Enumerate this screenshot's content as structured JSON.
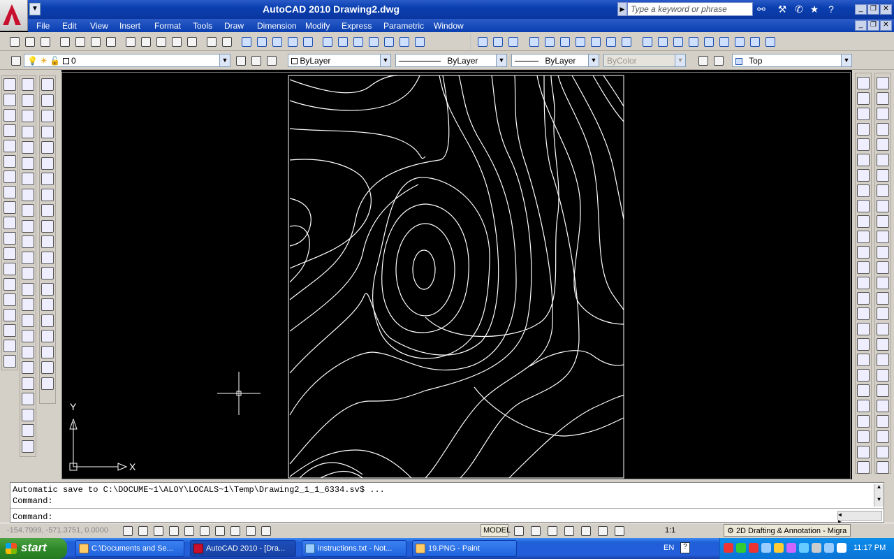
{
  "window": {
    "title": "AutoCAD 2010    Drawing2.dwg",
    "search_placeholder": "Type a keyword or phrase"
  },
  "menu": [
    "File",
    "Edit",
    "View",
    "Insert",
    "Format",
    "Tools",
    "Draw",
    "Dimension",
    "Modify",
    "Express",
    "Parametric",
    "Window"
  ],
  "layers_toolbar": {
    "layer_value": "0",
    "color_value": "ByLayer",
    "linetype_value": "ByLayer",
    "lineweight_value": "ByLayer",
    "plotstyle_value": "ByColor",
    "view_value": "Top"
  },
  "ucs": {
    "x_label": "X",
    "y_label": "Y"
  },
  "command": {
    "history_line": "Automatic save to C:\\DOCUME~1\\ALOY\\LOCALS~1\\Temp\\Drawing2_1_1_6334.sv$ ...",
    "prev_prompt": "Command:",
    "prompt": "Command:"
  },
  "status": {
    "coordinates": "-154.7999, -571.3751, 0.0000",
    "model_label": "MODEL",
    "scale": "1:1",
    "workspace": "2D Drafting & Annotation - Migra"
  },
  "taskbar": {
    "start_label": "start",
    "tasks": [
      {
        "label": "C:\\Documents and Se..."
      },
      {
        "label": "AutoCAD 2010 - [Dra..."
      },
      {
        "label": "instructions.txt - Not..."
      },
      {
        "label": "19.PNG - Paint"
      }
    ],
    "lang": "EN",
    "clock": "11:17 PM"
  }
}
